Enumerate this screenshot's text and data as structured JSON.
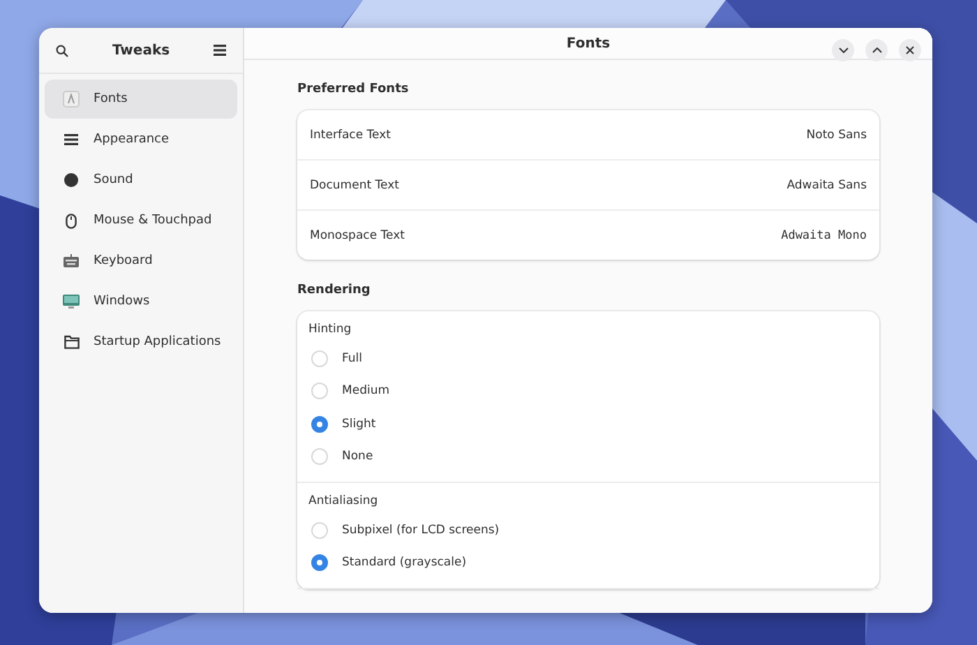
{
  "sidebar": {
    "title": "Tweaks",
    "items": [
      {
        "label": "Fonts",
        "selected": true
      },
      {
        "label": "Appearance",
        "selected": false
      },
      {
        "label": "Sound",
        "selected": false
      },
      {
        "label": "Mouse & Touchpad",
        "selected": false
      },
      {
        "label": "Keyboard",
        "selected": false
      },
      {
        "label": "Windows",
        "selected": false
      },
      {
        "label": "Startup Applications",
        "selected": false
      }
    ]
  },
  "window": {
    "title": "Fonts"
  },
  "preferred_fonts": {
    "title": "Preferred Fonts",
    "rows": [
      {
        "label": "Interface Text",
        "value": "Noto Sans",
        "kind": "sans"
      },
      {
        "label": "Document Text",
        "value": "Adwaita Sans",
        "kind": "sans"
      },
      {
        "label": "Monospace Text",
        "value": "Adwaita Mono",
        "kind": "mono"
      }
    ]
  },
  "rendering": {
    "title": "Rendering",
    "groups": [
      {
        "title": "Hinting",
        "options": [
          {
            "label": "Full",
            "selected": false
          },
          {
            "label": "Medium",
            "selected": false
          },
          {
            "label": "Slight",
            "selected": true
          },
          {
            "label": "None",
            "selected": false
          }
        ]
      },
      {
        "title": "Antialiasing",
        "options": [
          {
            "label": "Subpixel (for LCD screens)",
            "selected": false
          },
          {
            "label": "Standard (grayscale)",
            "selected": true
          }
        ]
      }
    ]
  }
}
